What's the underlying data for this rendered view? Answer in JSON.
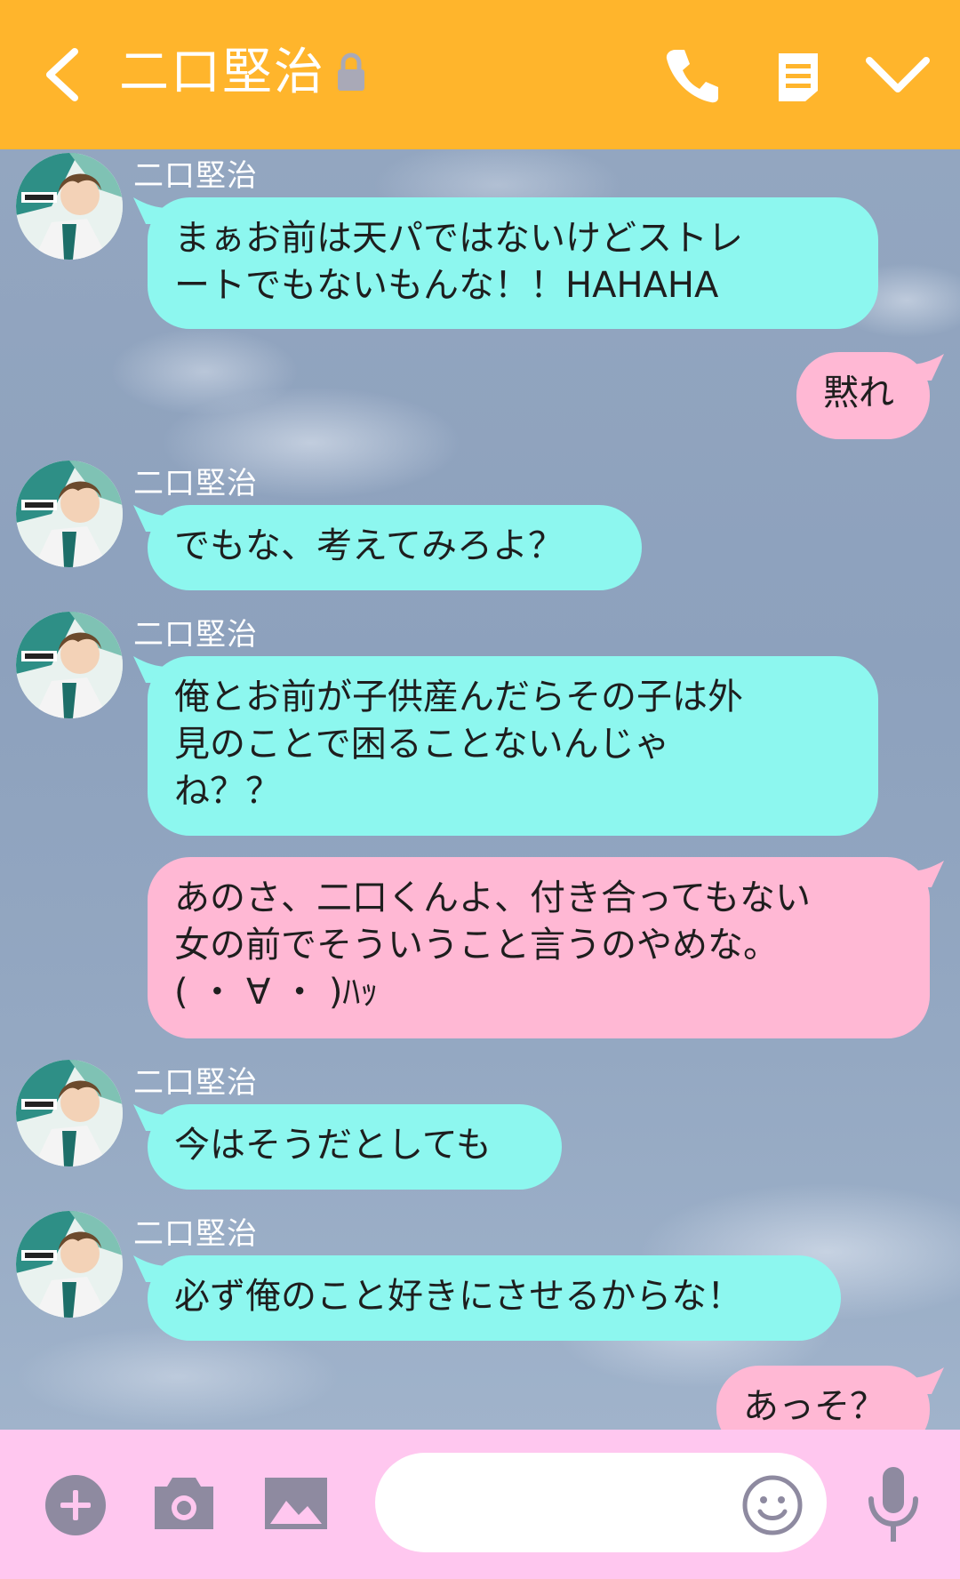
{
  "header": {
    "title": "二口堅治",
    "background_color": "#ffb52c",
    "icons": [
      "back-icon",
      "lock-icon",
      "call-icon",
      "memo-icon",
      "chevron-down-icon"
    ]
  },
  "messages": [
    {
      "side": "in",
      "sender": "二口堅治",
      "text": "まぁお前は天パではないけどストレ\nートでもないもんな！！HAHAHA"
    },
    {
      "side": "out",
      "text": "黙れ"
    },
    {
      "side": "in",
      "sender": "二口堅治",
      "text": "でもな、考えてみろよ？"
    },
    {
      "side": "in",
      "sender": "二口堅治",
      "text": "俺とお前が子供産んだらその子は外\n見のことで困ることないんじゃ\nね？？"
    },
    {
      "side": "out",
      "text": "あのさ、二口くんよ、付き合ってもない\n女の前でそういうこと言うのやめな。\n( ・ ∀ ・ )ﾊｯ"
    },
    {
      "side": "in",
      "sender": "二口堅治",
      "text": "今はそうだとしても"
    },
    {
      "side": "in",
      "sender": "二口堅治",
      "text": "必ず俺のこと好きにさせるからな！"
    },
    {
      "side": "out",
      "text": "あっそ？"
    }
  ],
  "colors": {
    "incoming_bubble": "#8df7ef",
    "outgoing_bubble": "#ffb8d4",
    "input_bar": "#ffc7ef",
    "icon_gray": "#8e8aa0"
  },
  "input_bar": {
    "icons": [
      "plus-icon",
      "camera-icon",
      "image-icon",
      "smiley-icon",
      "microphone-icon"
    ],
    "message_value": ""
  }
}
